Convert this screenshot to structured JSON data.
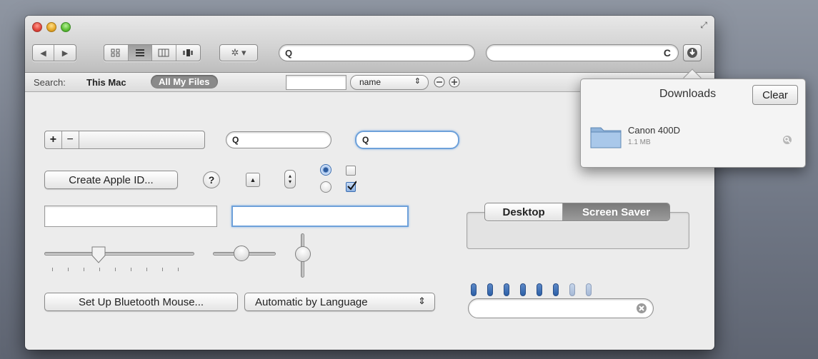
{
  "toolbar": {
    "nav_back": "◀",
    "nav_forward": "▶",
    "view_icons": [
      "icon-view-icon",
      "list-view-icon",
      "column-view-icon",
      "coverflow-view-icon"
    ],
    "action_menu": "✲ ▾",
    "search_glyph": "Q",
    "url_reload": "C"
  },
  "search_bar": {
    "label": "Search:",
    "scope_this_mac": "This Mac",
    "scope_all_files": "All My Files",
    "criteria_select": "name",
    "criteria_stepper": "⌃⌄"
  },
  "downloads": {
    "title": "Downloads",
    "clear_label": "Clear",
    "item_name": "Canon 400D",
    "item_size": "1.1 MB"
  },
  "controls": {
    "add_label": "+",
    "remove_label": "−",
    "search_glyph": "Q",
    "create_apple_id": "Create Apple ID...",
    "help_label": "?",
    "disclosure_up": "▲",
    "bluetooth_button": "Set Up Bluetooth Mouse...",
    "language_select": "Automatic by Language",
    "tab_desktop": "Desktop",
    "tab_screen_saver": "Screen Saver"
  },
  "level_indicator": {
    "total": 8,
    "filled": 6
  },
  "colors": {
    "focus_ring": "#6ea1da",
    "selected_scope": "#8a8a8a",
    "indicator_on": "#2b5fa6",
    "indicator_off": "#a6b9d6"
  }
}
